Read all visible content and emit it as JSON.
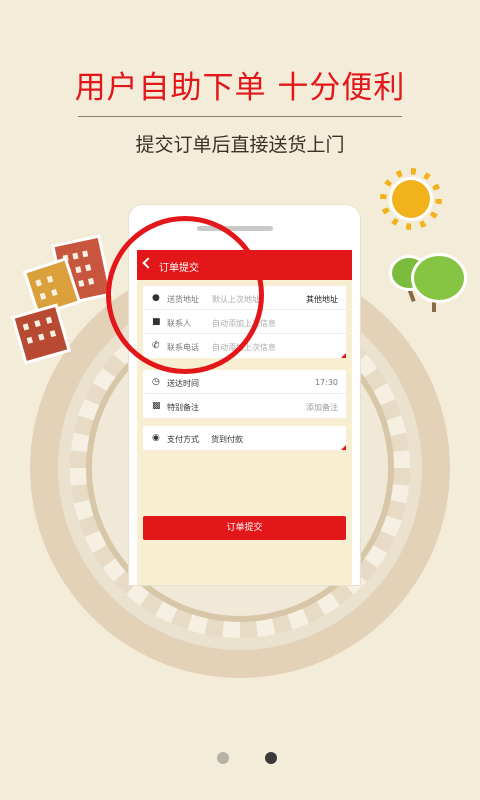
{
  "headline": "用户自助下单 十分便利",
  "subheadline": "提交订单后直接送货上门",
  "phone": {
    "header": {
      "title": "订单提交"
    },
    "address_card": {
      "rows": [
        {
          "icon": "location-pin-icon",
          "label": "送货地址",
          "placeholder": "默认上次地址",
          "action": "其他地址"
        },
        {
          "icon": "person-icon",
          "label": "联系人",
          "placeholder": "自动添加上次信息"
        },
        {
          "icon": "phone-icon",
          "label": "联系电话",
          "placeholder": "自动添加上次信息"
        }
      ]
    },
    "delivery_card": {
      "rows": [
        {
          "icon": "clock-icon",
          "label": "送达时间",
          "value": "17:30"
        },
        {
          "icon": "chat-bubble-icon",
          "label": "特别备注",
          "value": "添加备注"
        }
      ]
    },
    "payment_card": {
      "icon": "wallet-icon",
      "label": "支付方式",
      "value": "货到付款"
    },
    "submit_label": "订单提交"
  },
  "pager": {
    "total": 2,
    "active_index": 1
  },
  "colors": {
    "accent": "#e3171a",
    "background": "#f3ecd8",
    "screen": "#f8efd3"
  }
}
